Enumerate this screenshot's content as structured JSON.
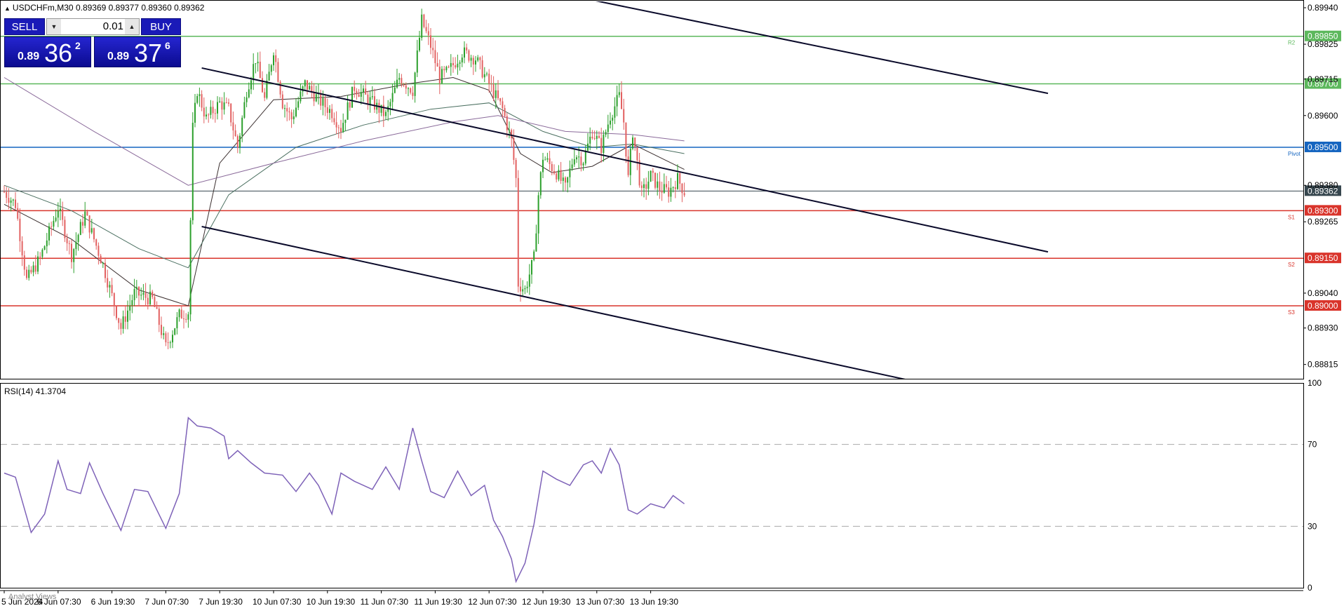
{
  "header": {
    "symbol_title": "USDCHFm,M30",
    "ohlc": "0.89369 0.89377 0.89360 0.89362"
  },
  "trade_panel": {
    "sell_label": "SELL",
    "buy_label": "BUY",
    "lot_value": "0.01",
    "sell_price_small": "0.89",
    "sell_price_big": "36",
    "sell_price_sup": "2",
    "buy_price_small": "0.89",
    "buy_price_big": "37",
    "buy_price_sup": "6"
  },
  "analyst_label": "Analyst Views",
  "colors": {
    "bull": "#2ca02c",
    "bear": "#e26060",
    "resistance": "#5cb85c",
    "pivot": "#1565c0",
    "support": "#d9342b",
    "current": "#37474f",
    "rsi": "#7e62b8",
    "channel": "#0a0a2a"
  },
  "chart_data": [
    {
      "type": "candlestick",
      "instrument": "USDCHFm",
      "timeframe": "M30",
      "y_axis_ticks": [
        "0.89940",
        "0.89825",
        "0.89715",
        "0.89600",
        "0.89380",
        "0.89265",
        "0.89040",
        "0.88930",
        "0.88815"
      ],
      "ylim": [
        0.8877,
        0.8996
      ],
      "x_tick_labels": [
        "5 Jun 2024",
        "6 Jun 07:30",
        "6 Jun 19:30",
        "7 Jun 07:30",
        "7 Jun 19:30",
        "10 Jun 07:30",
        "10 Jun 19:30",
        "11 Jun 07:30",
        "11 Jun 19:30",
        "12 Jun 07:30",
        "12 Jun 19:30",
        "13 Jun 07:30",
        "13 Jun 19:30"
      ],
      "x_tick_index": [
        0,
        24,
        48,
        72,
        96,
        120,
        144,
        168,
        192,
        216,
        240,
        264,
        288
      ],
      "price_levels": [
        {
          "price": 0.8985,
          "label": "0.89850",
          "tag": "R2",
          "kind": "resistance"
        },
        {
          "price": 0.897,
          "label": "0.89700",
          "tag": "",
          "kind": "resistance"
        },
        {
          "price": 0.895,
          "label": "0.89500",
          "tag": "Pivot",
          "kind": "pivot"
        },
        {
          "price": 0.89362,
          "label": "0.89362",
          "tag": "",
          "kind": "current"
        },
        {
          "price": 0.893,
          "label": "0.89300",
          "tag": "S1",
          "kind": "support"
        },
        {
          "price": 0.8915,
          "label": "0.89150",
          "tag": "S2",
          "kind": "support"
        },
        {
          "price": 0.89,
          "label": "0.89000",
          "tag": "S3",
          "kind": "support"
        }
      ],
      "price_path": [
        [
          0,
          0.8936
        ],
        [
          5,
          0.8932
        ],
        [
          10,
          0.8908
        ],
        [
          16,
          0.8915
        ],
        [
          24,
          0.8931
        ],
        [
          30,
          0.8916
        ],
        [
          36,
          0.8929
        ],
        [
          44,
          0.8913
        ],
        [
          52,
          0.8893
        ],
        [
          58,
          0.8904
        ],
        [
          66,
          0.8902
        ],
        [
          72,
          0.8887
        ],
        [
          78,
          0.8897
        ],
        [
          82,
          0.8898
        ],
        [
          84,
          0.8956
        ],
        [
          86,
          0.8968
        ],
        [
          90,
          0.8959
        ],
        [
          96,
          0.8964
        ],
        [
          100,
          0.8962
        ],
        [
          104,
          0.895
        ],
        [
          108,
          0.8968
        ],
        [
          112,
          0.8978
        ],
        [
          116,
          0.8965
        ],
        [
          120,
          0.8981
        ],
        [
          124,
          0.8964
        ],
        [
          128,
          0.8959
        ],
        [
          134,
          0.897
        ],
        [
          140,
          0.8965
        ],
        [
          146,
          0.8961
        ],
        [
          150,
          0.8956
        ],
        [
          156,
          0.8969
        ],
        [
          164,
          0.8964
        ],
        [
          170,
          0.896
        ],
        [
          176,
          0.8972
        ],
        [
          182,
          0.8968
        ],
        [
          186,
          0.899
        ],
        [
          190,
          0.8982
        ],
        [
          194,
          0.8972
        ],
        [
          198,
          0.8974
        ],
        [
          204,
          0.898
        ],
        [
          210,
          0.8978
        ],
        [
          216,
          0.897
        ],
        [
          222,
          0.8962
        ],
        [
          226,
          0.8952
        ],
        [
          228,
          0.894
        ],
        [
          229,
          0.8907
        ],
        [
          232,
          0.8905
        ],
        [
          236,
          0.8915
        ],
        [
          238,
          0.8935
        ],
        [
          240,
          0.8947
        ],
        [
          246,
          0.8942
        ],
        [
          250,
          0.8937
        ],
        [
          254,
          0.8948
        ],
        [
          258,
          0.8946
        ],
        [
          262,
          0.8955
        ],
        [
          266,
          0.895
        ],
        [
          270,
          0.896
        ],
        [
          274,
          0.8966
        ],
        [
          276,
          0.8958
        ],
        [
          278,
          0.894
        ],
        [
          280,
          0.8955
        ],
        [
          284,
          0.8935
        ],
        [
          288,
          0.8941
        ],
        [
          292,
          0.8937
        ],
        [
          296,
          0.8936
        ],
        [
          300,
          0.894
        ],
        [
          303,
          0.8936
        ]
      ],
      "moving_averages": [
        {
          "color": "#3b2f2f",
          "points": [
            [
              0,
              0.8932
            ],
            [
              30,
              0.8921
            ],
            [
              60,
              0.8905
            ],
            [
              82,
              0.89
            ],
            [
              96,
              0.8945
            ],
            [
              120,
              0.8965
            ],
            [
              150,
              0.8966
            ],
            [
              180,
              0.897
            ],
            [
              200,
              0.8972
            ],
            [
              216,
              0.8968
            ],
            [
              230,
              0.8948
            ],
            [
              244,
              0.8942
            ],
            [
              262,
              0.8944
            ],
            [
              280,
              0.8951
            ],
            [
              303,
              0.8943
            ]
          ]
        },
        {
          "color": "#4a6f60",
          "points": [
            [
              0,
              0.8938
            ],
            [
              30,
              0.893
            ],
            [
              60,
              0.8918
            ],
            [
              82,
              0.8912
            ],
            [
              100,
              0.8935
            ],
            [
              130,
              0.895
            ],
            [
              160,
              0.8957
            ],
            [
              190,
              0.8962
            ],
            [
              216,
              0.8964
            ],
            [
              240,
              0.8955
            ],
            [
              262,
              0.895
            ],
            [
              280,
              0.8951
            ],
            [
              303,
              0.8948
            ]
          ]
        },
        {
          "color": "#8a6a9a",
          "points": [
            [
              0,
              0.8972
            ],
            [
              40,
              0.8955
            ],
            [
              82,
              0.8938
            ],
            [
              120,
              0.8945
            ],
            [
              160,
              0.8952
            ],
            [
              200,
              0.8958
            ],
            [
              220,
              0.896
            ],
            [
              250,
              0.8955
            ],
            [
              280,
              0.8954
            ],
            [
              303,
              0.8952
            ]
          ]
        }
      ],
      "channel_lines": [
        {
          "from": [
            88,
            0.8975
          ],
          "to": [
            465,
            0.8917
          ]
        },
        {
          "from": [
            88,
            0.8925
          ],
          "to": [
            465,
            0.8867
          ]
        },
        {
          "from": [
            258,
            0.8997
          ],
          "to": [
            465,
            0.8967
          ]
        }
      ]
    },
    {
      "type": "line",
      "title": "RSI(14)",
      "last_value": "41.3704",
      "label": "RSI(14) 41.3704",
      "ylim": [
        0,
        100
      ],
      "y_ticks": [
        0,
        30,
        70,
        100
      ],
      "levels": [
        30,
        70
      ],
      "values": [
        [
          0,
          56
        ],
        [
          5,
          54
        ],
        [
          12,
          27
        ],
        [
          18,
          36
        ],
        [
          24,
          62
        ],
        [
          28,
          48
        ],
        [
          34,
          46
        ],
        [
          38,
          61
        ],
        [
          44,
          46
        ],
        [
          52,
          28
        ],
        [
          58,
          48
        ],
        [
          64,
          47
        ],
        [
          72,
          29
        ],
        [
          78,
          46
        ],
        [
          82,
          83
        ],
        [
          86,
          79
        ],
        [
          92,
          78
        ],
        [
          98,
          74
        ],
        [
          100,
          63
        ],
        [
          104,
          67
        ],
        [
          110,
          61
        ],
        [
          116,
          56
        ],
        [
          124,
          55
        ],
        [
          130,
          47
        ],
        [
          136,
          56
        ],
        [
          140,
          50
        ],
        [
          146,
          36
        ],
        [
          150,
          56
        ],
        [
          156,
          52
        ],
        [
          164,
          48
        ],
        [
          170,
          59
        ],
        [
          176,
          48
        ],
        [
          182,
          78
        ],
        [
          186,
          62
        ],
        [
          190,
          47
        ],
        [
          196,
          44
        ],
        [
          202,
          57
        ],
        [
          208,
          45
        ],
        [
          214,
          50
        ],
        [
          218,
          33
        ],
        [
          222,
          25
        ],
        [
          226,
          14
        ],
        [
          228,
          3
        ],
        [
          232,
          12
        ],
        [
          236,
          31
        ],
        [
          240,
          57
        ],
        [
          246,
          53
        ],
        [
          252,
          50
        ],
        [
          258,
          60
        ],
        [
          262,
          62
        ],
        [
          266,
          56
        ],
        [
          270,
          68
        ],
        [
          274,
          60
        ],
        [
          278,
          38
        ],
        [
          282,
          36
        ],
        [
          288,
          41
        ],
        [
          294,
          39
        ],
        [
          298,
          45
        ],
        [
          303,
          41
        ]
      ]
    }
  ]
}
